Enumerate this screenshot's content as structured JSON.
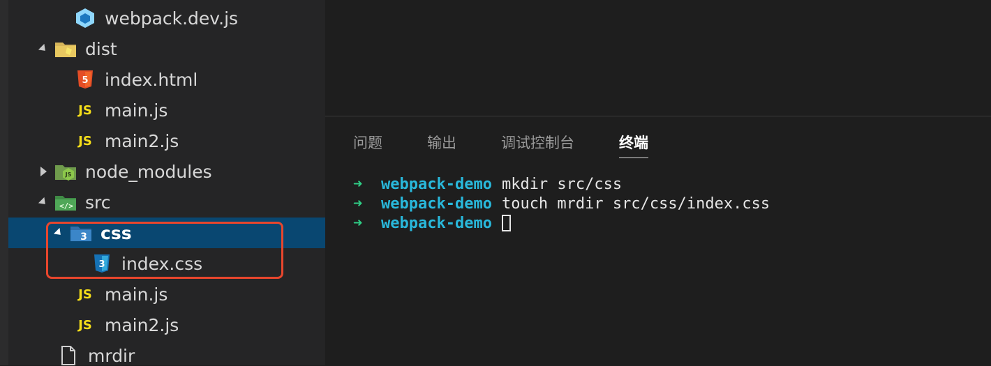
{
  "explorer": {
    "items": [
      {
        "label": "webpack.dev.js",
        "icon": "webpack-icon"
      },
      {
        "label": "dist",
        "icon": "dist-folder-icon"
      },
      {
        "label": "index.html",
        "icon": "html5-icon"
      },
      {
        "label": "main.js",
        "icon": "js-icon",
        "icon_text": "JS"
      },
      {
        "label": "main2.js",
        "icon": "js-icon",
        "icon_text": "JS"
      },
      {
        "label": "node_modules",
        "icon": "node-folder-icon"
      },
      {
        "label": "src",
        "icon": "src-folder-icon"
      },
      {
        "label": "css",
        "icon": "css-folder-icon"
      },
      {
        "label": "index.css",
        "icon": "css3-icon"
      },
      {
        "label": "main.js",
        "icon": "js-icon",
        "icon_text": "JS"
      },
      {
        "label": "main2.js",
        "icon": "js-icon",
        "icon_text": "JS"
      },
      {
        "label": "mrdir",
        "icon": "file-icon"
      }
    ]
  },
  "panel": {
    "tabs": [
      "问题",
      "输出",
      "调试控制台",
      "终端"
    ],
    "active_tab": "终端"
  },
  "terminal": {
    "prompt_arrow": "➜",
    "cwd": "webpack-demo",
    "lines": [
      {
        "command": "mkdir src/css"
      },
      {
        "command": "touch mrdir src/css/index.css"
      },
      {
        "command": ""
      }
    ]
  },
  "colors": {
    "sidebar_bg": "#252526",
    "selection_bg": "#094771",
    "highlight_border": "#e8462d",
    "prompt_arrow": "#2fce86",
    "cwd": "#29b8db",
    "js_icon": "#f5de19"
  }
}
